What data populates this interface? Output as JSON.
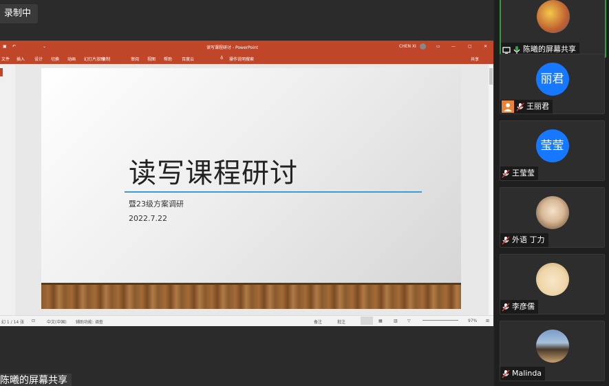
{
  "recording": {
    "label": "录制中"
  },
  "ppt": {
    "window_title": "读写课程研讨 - PowerPoint",
    "user": "CHEN XI",
    "ribbon_tabs": [
      "文件",
      "插入",
      "设计",
      "切换",
      "动画",
      "幻灯片放映",
      "录制",
      "审阅",
      "视图",
      "帮助",
      "百度云"
    ],
    "tell_me": "操作说明搜索",
    "share": "共享",
    "slide": {
      "title": "读写课程研讨",
      "subtitle": "暨23级方案调研",
      "date": "2022.7.22"
    },
    "status": {
      "slide_count": "幻 1 / 14 张",
      "language": "中文(中国)",
      "accessibility": "辅助功能: 调查",
      "notes": "备注",
      "comments": "批注",
      "zoom": "97%"
    }
  },
  "screen_share_label": "陈曦的屏幕共享",
  "participants": [
    {
      "name": "陈曦的屏幕共享",
      "avatar": "cartoon-avatar",
      "muted": false,
      "active": true
    },
    {
      "name": "王丽君",
      "avatar_text": "丽君",
      "muted": true,
      "host": true
    },
    {
      "name": "王莹莹",
      "avatar_text": "莹莹",
      "muted": true
    },
    {
      "name": "外语 丁力",
      "avatar": "cat-photo",
      "muted": true
    },
    {
      "name": "李彦儒",
      "avatar": "cartoon-face",
      "muted": true
    },
    {
      "name": "Malinda",
      "avatar": "landscape-photo",
      "muted": true
    }
  ],
  "colors": {
    "ppt_accent": "#c0462a",
    "active_border": "#2ea043",
    "avatar_blue": "#1677ff"
  }
}
